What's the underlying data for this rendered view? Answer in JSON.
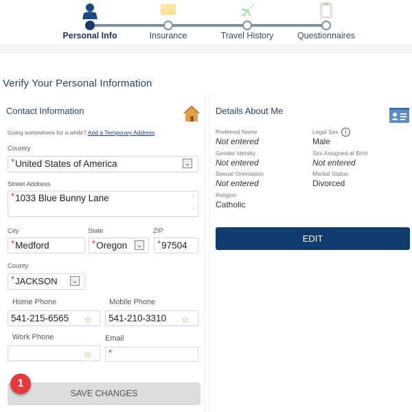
{
  "stepper": {
    "steps": [
      {
        "label": "Personal Info",
        "icon": "person-icon",
        "active": true
      },
      {
        "label": "Insurance",
        "icon": "insurance-card-icon",
        "active": false
      },
      {
        "label": "Travel History",
        "icon": "airplane-icon",
        "active": false
      },
      {
        "label": "Questionnaires",
        "icon": "clipboard-icon",
        "active": false
      }
    ]
  },
  "page_title": "Verify Your Personal Information",
  "contact": {
    "title": "Contact Information",
    "icon": "house-icon",
    "temp_prompt": "Going somewhere for a while?",
    "temp_link": "Add a Temporary Address",
    "country_label": "Country",
    "country_value": "United States of America",
    "street_label": "Street Address",
    "street_value": "1033 Blue Bunny Lane",
    "city_label": "City",
    "city_value": "Medford",
    "state_label": "State",
    "state_value": "Oregon",
    "zip_label": "ZIP",
    "zip_value": "97504",
    "county_label": "County",
    "county_value": "JACKSON",
    "home_phone_label": "Home Phone",
    "home_phone_value": "541-215-6565",
    "mobile_phone_label": "Mobile Phone",
    "mobile_phone_value": "541-210-3310",
    "work_phone_label": "Work Phone",
    "work_phone_value": "",
    "email_label": "Email",
    "email_value": "",
    "required_mark": "*",
    "save_label": "SAVE CHANGES",
    "badge_count": "1"
  },
  "details": {
    "title": "Details About Me",
    "icon": "id-card-icon",
    "preferred_name_label": "Preferred Name",
    "preferred_name_value": "Not entered",
    "legal_sex_label": "Legal Sex",
    "legal_sex_value": "Male",
    "gender_identity_label": "Gender Identity",
    "gender_identity_value": "Not entered",
    "sex_at_birth_label": "Sex Assigned at Birth",
    "sex_at_birth_value": "Not entered",
    "sexual_orientation_label": "Sexual Orientation",
    "sexual_orientation_value": "Not entered",
    "marital_status_label": "Marital Status",
    "marital_status_value": "Divorced",
    "religion_label": "Religion",
    "religion_value": "Catholic",
    "edit_label": "EDIT"
  },
  "colors": {
    "brand_navy": "#0f3c6c",
    "required_red": "#c0304a",
    "badge_red": "#e23a3d"
  }
}
